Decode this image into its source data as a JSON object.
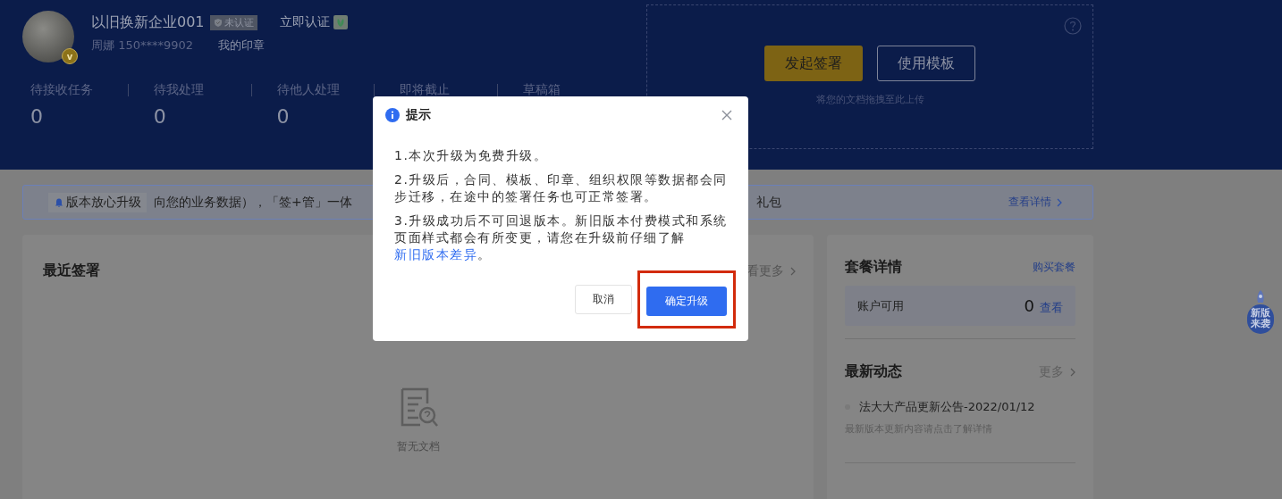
{
  "header": {
    "avatar_badge": "v",
    "company_name": "以旧换新企业001",
    "cert_badge": "未认证",
    "certify_link": "立即认证",
    "user": "周娜 150****9902",
    "seal_link": "我的印章",
    "stats": [
      {
        "label": "待接收任务",
        "value": "0"
      },
      {
        "label": "待我处理",
        "value": "0"
      },
      {
        "label": "待他人处理",
        "value": "0"
      },
      {
        "label": "即将截止"
      },
      {
        "label": "草稿箱"
      }
    ]
  },
  "upload": {
    "buttons": [
      {
        "label": "发起签署",
        "kind": "primary"
      },
      {
        "label": "使用模板",
        "kind": "outline"
      }
    ],
    "hint": "将您的文档拖拽至此上传"
  },
  "banner": {
    "tag": "版本放心升级",
    "text": "向您的业务数据），「签+管」一体",
    "text_end": "礼包",
    "link": "查看详情"
  },
  "recent": {
    "title": "最近签署",
    "more": "看更多",
    "empty": "暂无文档"
  },
  "package": {
    "title": "套餐详情",
    "buy_link": "购买套餐",
    "account_label": "账户可用",
    "count": "0",
    "view_link": "查看"
  },
  "news": {
    "title": "最新动态",
    "more": "更多",
    "items": [
      {
        "title": "法大大产品更新公告-2022/01/12",
        "desc": "最新版本更新内容请点击了解详情"
      }
    ]
  },
  "float_badge": {
    "lines": [
      "新版",
      "来袭"
    ]
  },
  "dialog": {
    "title": "提示",
    "paragraphs": [
      {
        "text": "1.本次升级为免费升级。"
      },
      {
        "text": "2.升级后，合同、模板、印章、组织权限等数据都会同步迁移，在途中的签署任务也可正常签署。"
      },
      {
        "text": "3.升级成功后不可回退版本。新旧版本付费模式和系统页面样式都会有所变更，请您在升级前仔细了解",
        "link": "新旧版本差异",
        "end": "。"
      }
    ],
    "buttons": [
      {
        "label": "取消",
        "kind": "default",
        "highlighted": false
      },
      {
        "label": "确定升级",
        "kind": "primary",
        "highlighted": true
      }
    ]
  }
}
